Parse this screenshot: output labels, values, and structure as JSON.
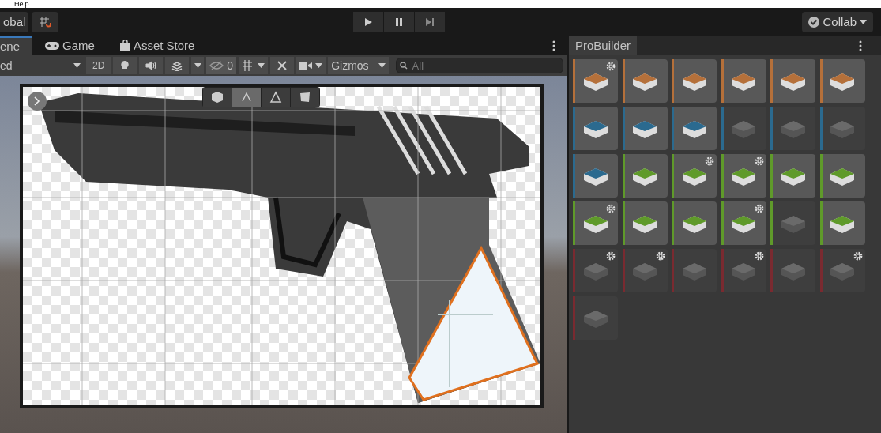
{
  "menu_bar": {
    "items": [
      "Help"
    ]
  },
  "toolbar": {
    "pivot_button": "obal",
    "collab_button": "Collab"
  },
  "scene_panel": {
    "tabs": [
      {
        "label": "ene",
        "selected": true
      },
      {
        "label": "Game",
        "selected": false
      },
      {
        "label": "Asset Store",
        "selected": false
      }
    ],
    "shading_dropdown": "ed",
    "mode_2d": "2D",
    "hidden_count": "0",
    "gizmos": "Gizmos",
    "search": {
      "placeholder": "All"
    },
    "edit_modes": [
      {
        "selected": false
      },
      {
        "selected": true
      },
      {
        "selected": false
      },
      {
        "selected": false
      }
    ]
  },
  "probuilder": {
    "title": "ProBuilder",
    "tools": [
      {
        "color": "#b5703a",
        "disabled": false,
        "settings": true
      },
      {
        "color": "#b5703a",
        "disabled": false,
        "settings": false
      },
      {
        "color": "#b5703a",
        "disabled": false,
        "settings": false
      },
      {
        "color": "#b5703a",
        "disabled": false,
        "settings": false
      },
      {
        "color": "#b5703a",
        "disabled": false,
        "settings": false
      },
      {
        "color": "#b5703a",
        "disabled": false,
        "settings": false
      },
      {
        "color": "#2b6a8f",
        "disabled": false,
        "settings": false
      },
      {
        "color": "#2b6a8f",
        "disabled": false,
        "settings": false
      },
      {
        "color": "#2b6a8f",
        "disabled": false,
        "settings": false
      },
      {
        "color": "#2b6a8f",
        "disabled": true,
        "settings": false
      },
      {
        "color": "#2b6a8f",
        "disabled": true,
        "settings": false
      },
      {
        "color": "#2b6a8f",
        "disabled": true,
        "settings": false
      },
      {
        "color": "#2b6a8f",
        "disabled": false,
        "settings": false
      },
      {
        "color": "#5f9a2a",
        "disabled": false,
        "settings": false
      },
      {
        "color": "#5f9a2a",
        "disabled": false,
        "settings": true
      },
      {
        "color": "#5f9a2a",
        "disabled": false,
        "settings": true
      },
      {
        "color": "#5f9a2a",
        "disabled": false,
        "settings": false
      },
      {
        "color": "#5f9a2a",
        "disabled": false,
        "settings": false
      },
      {
        "color": "#5f9a2a",
        "disabled": false,
        "settings": true
      },
      {
        "color": "#5f9a2a",
        "disabled": false,
        "settings": false
      },
      {
        "color": "#5f9a2a",
        "disabled": false,
        "settings": false
      },
      {
        "color": "#5f9a2a",
        "disabled": false,
        "settings": true
      },
      {
        "color": "#5f9a2a",
        "disabled": true,
        "settings": false
      },
      {
        "color": "#5f9a2a",
        "disabled": false,
        "settings": false
      },
      {
        "color": "#7a2a30",
        "disabled": true,
        "settings": true
      },
      {
        "color": "#7a2a30",
        "disabled": true,
        "settings": true
      },
      {
        "color": "#7a2a30",
        "disabled": true,
        "settings": false
      },
      {
        "color": "#7a2a30",
        "disabled": true,
        "settings": true
      },
      {
        "color": "#7a2a30",
        "disabled": true,
        "settings": false
      },
      {
        "color": "#7a2a30",
        "disabled": true,
        "settings": true
      },
      {
        "color": "#7a2a30",
        "disabled": true,
        "settings": false
      }
    ]
  }
}
